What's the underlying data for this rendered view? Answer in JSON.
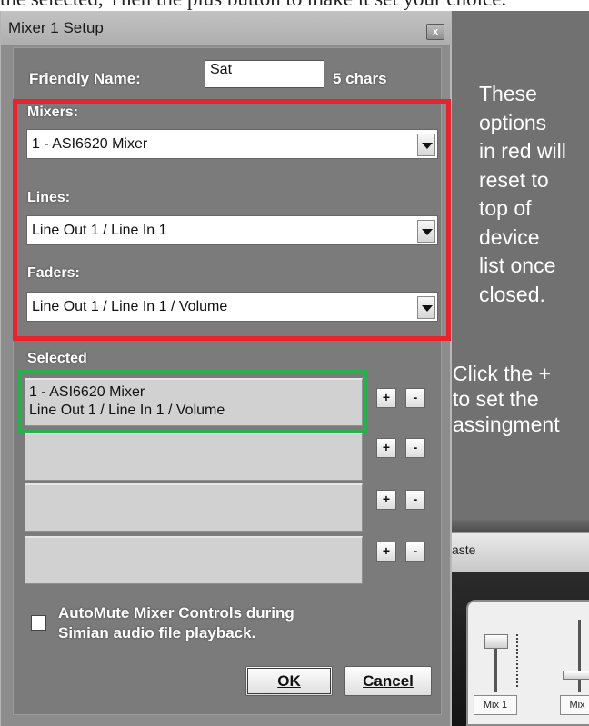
{
  "top_text": "the selected, Then the plus button to make it set your choice.",
  "dialog": {
    "title": "Mixer 1 Setup",
    "close_glyph": "x",
    "friendly_name_label": "Friendly Name:",
    "friendly_name_value": "Sat",
    "char_count": "5 chars",
    "mixers_label": "Mixers:",
    "mixers_value": "1 - ASI6620 Mixer",
    "lines_label": "Lines:",
    "lines_value": "Line Out 1 / Line In 1",
    "faders_label": "Faders:",
    "faders_value": "Line Out 1 / Line In 1 / Volume",
    "selected_label": "Selected",
    "slot1_line1": "1 - ASI6620 Mixer",
    "slot1_line2": "Line Out 1 / Line In 1 / Volume",
    "plus": "+",
    "minus": "-",
    "automute_line1": "AutoMute Mixer Controls during",
    "automute_line2": "Simian audio file playback.",
    "ok_label": "OK",
    "cancel_label": "Cancel"
  },
  "annotations": {
    "red_note": [
      "These",
      "options",
      "in red will",
      "reset to",
      "top of",
      "device",
      "list once",
      "closed."
    ],
    "green_note": [
      "Click the +",
      "to set the",
      "assingment"
    ]
  },
  "background_app": {
    "toolbar_text": "aste",
    "mix1_label": "Mix 1",
    "mix2_label": "Mix"
  },
  "colors": {
    "annotation_red": "#e8232d",
    "annotation_green": "#27b04b"
  }
}
